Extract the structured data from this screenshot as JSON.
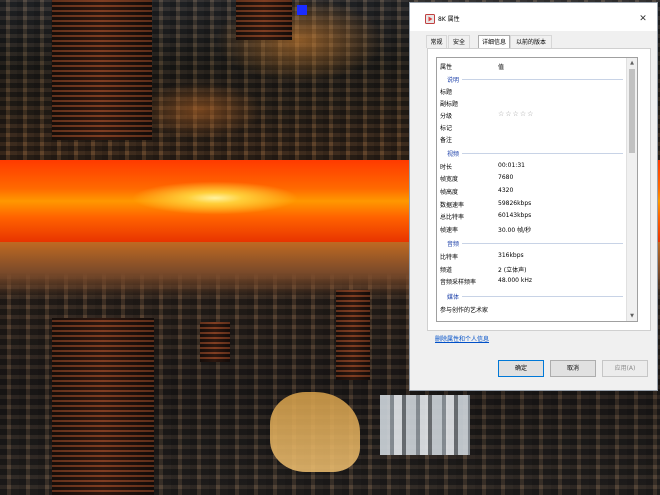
{
  "window": {
    "title": "8K 属性",
    "close_glyph": "✕"
  },
  "tabs": [
    {
      "label": "常规",
      "active": false
    },
    {
      "label": "安全",
      "active": false
    },
    {
      "label": "详细信息",
      "active": true
    },
    {
      "label": "以前的版本",
      "active": false
    }
  ],
  "list": {
    "header": {
      "property": "属性",
      "value": "值"
    },
    "sections": {
      "description": "说明",
      "video": "视频",
      "audio": "音频",
      "media": "媒体"
    },
    "rows": {
      "title": {
        "key": "标题",
        "value": ""
      },
      "subtitle": {
        "key": "副标题",
        "value": ""
      },
      "rating": {
        "key": "分级",
        "stars": "☆☆☆☆☆"
      },
      "tags": {
        "key": "标记",
        "value": ""
      },
      "comments": {
        "key": "备注",
        "value": ""
      },
      "length": {
        "key": "时长",
        "value": "00:01:31"
      },
      "frame_width": {
        "key": "帧宽度",
        "value": "7680"
      },
      "frame_height": {
        "key": "帧高度",
        "value": "4320"
      },
      "data_rate": {
        "key": "数据速率",
        "value": "59826kbps"
      },
      "total_bitrate": {
        "key": "总比特率",
        "value": "60143kbps"
      },
      "frame_rate": {
        "key": "帧速率",
        "value": "30.00 帧/秒"
      },
      "audio_bitrate": {
        "key": "比特率",
        "value": "316kbps"
      },
      "channels": {
        "key": "频道",
        "value": "2 (立体声)"
      },
      "sample_rate": {
        "key": "音频采样频率",
        "value": "48.000 kHz"
      },
      "contributing_artists": {
        "key": "参与创作的艺术家",
        "value": ""
      }
    }
  },
  "remove_link": "删除属性和个人信息",
  "buttons": {
    "ok": "确定",
    "cancel": "取消",
    "apply": "应用(A)"
  },
  "scrollbar": {
    "up": "▲",
    "down": "▼"
  }
}
